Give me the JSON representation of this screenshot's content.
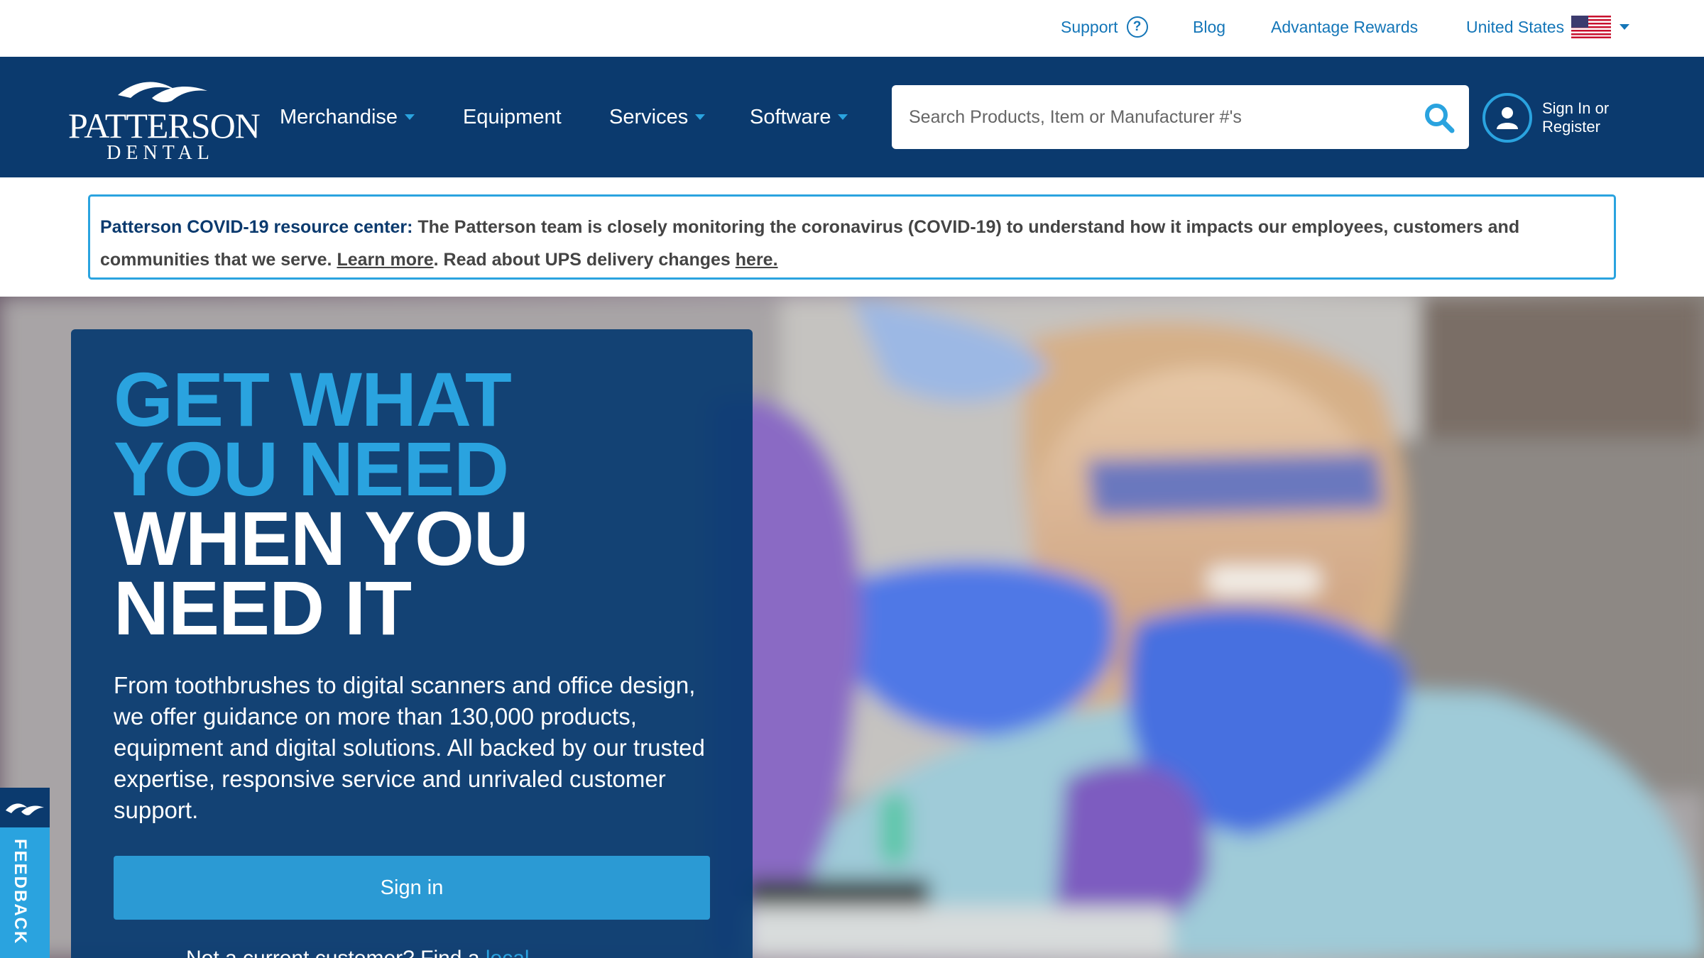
{
  "utility": {
    "support_label": "Support",
    "blog_label": "Blog",
    "rewards_label": "Advantage Rewards",
    "country_label": "United States"
  },
  "brand": {
    "name_top": "PATTERSON",
    "name_bottom": "DENTAL"
  },
  "nav": {
    "items": [
      {
        "label": "Merchandise",
        "has_menu": true
      },
      {
        "label": "Equipment",
        "has_menu": false
      },
      {
        "label": "Services",
        "has_menu": true
      },
      {
        "label": "Software",
        "has_menu": true
      }
    ]
  },
  "search": {
    "placeholder": "Search Products, Item or Manufacturer #'s",
    "value": ""
  },
  "account": {
    "signin_line1": "Sign In or",
    "signin_line2": "Register"
  },
  "covid": {
    "title": "Patterson COVID-19 resource center:",
    "text": " The Patterson team is closely monitoring the coronavirus (COVID-19) to understand how it impacts our employees, customers and communities that we serve. ",
    "learn_more": "Learn more",
    "text2": ". Read about UPS delivery changes ",
    "here": "here."
  },
  "hero": {
    "heading_line1": "GET WHAT",
    "heading_line2": "YOU NEED",
    "heading_line3": "WHEN YOU",
    "heading_line4": "NEED IT",
    "body": "From toothbrushes to digital scanners and office design, we offer guidance on more than 130,000 products, equipment and digital solutions. All backed by our trusted expertise, responsive service and unrivaled customer support.",
    "button_label": "Sign in",
    "footer_text": "Not a current customer? Find a ",
    "footer_link": "local"
  },
  "feedback": {
    "label": "FEEDBACK"
  },
  "colors": {
    "navy": "#0b3a6e",
    "accent": "#2aa3df",
    "link": "#1476b8"
  }
}
